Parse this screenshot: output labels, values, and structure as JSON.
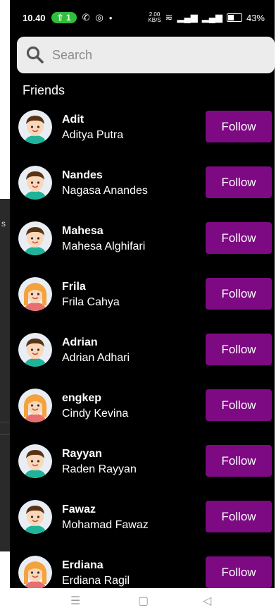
{
  "status_bar": {
    "time": "10.40",
    "notification_count": "1",
    "speed": "2.00",
    "speed_unit": "KB/S",
    "battery": "43%"
  },
  "search": {
    "placeholder": "Search"
  },
  "section_title": "Friends",
  "friends": [
    {
      "username": "Adit",
      "full_name": "Aditya Putra",
      "avatar": "boy",
      "button": "Follow"
    },
    {
      "username": "Nandes",
      "full_name": "Nagasa Anandes",
      "avatar": "boy",
      "button": "Follow"
    },
    {
      "username": "Mahesa",
      "full_name": "Mahesa Alghifari",
      "avatar": "boy",
      "button": "Follow"
    },
    {
      "username": "Frila",
      "full_name": "Frila Cahya",
      "avatar": "girl",
      "button": "Follow"
    },
    {
      "username": "Adrian",
      "full_name": "Adrian Adhari",
      "avatar": "boy",
      "button": "Follow"
    },
    {
      "username": "engkep",
      "full_name": "Cindy Kevina",
      "avatar": "girl",
      "button": "Follow"
    },
    {
      "username": "Rayyan",
      "full_name": "Raden Rayyan",
      "avatar": "boy",
      "button": "Follow"
    },
    {
      "username": "Fawaz",
      "full_name": "Mohamad Fawaz",
      "avatar": "boy",
      "button": "Follow"
    },
    {
      "username": "Erdiana",
      "full_name": "Erdiana Ragil",
      "avatar": "girl",
      "button": "Follow"
    }
  ],
  "colors": {
    "accent": "#7d0a82",
    "background": "#000000",
    "search_bg": "#ececec"
  },
  "nav_icons": [
    "menu-icon",
    "home-square-icon",
    "back-triangle-icon"
  ]
}
